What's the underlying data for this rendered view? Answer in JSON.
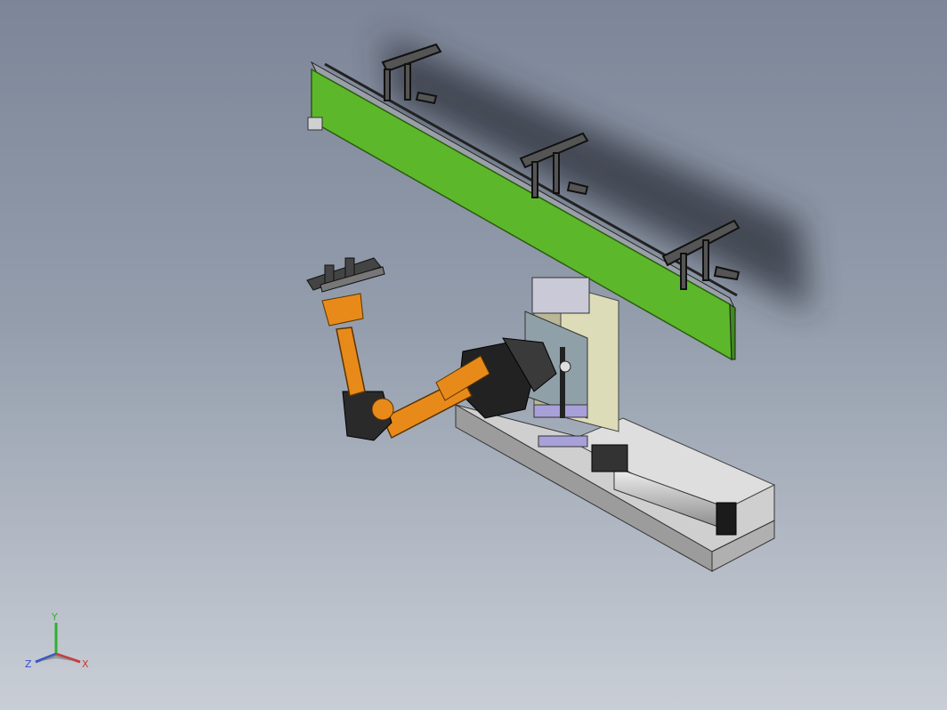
{
  "viewport": {
    "background_top": "#7d8698",
    "background_bottom": "#c9ced6"
  },
  "scene": {
    "panel_color": "#5cb82a",
    "robot_color": "#e88a1a",
    "column_color": "#dcdcb8",
    "base_color": "#c8c8c8",
    "cylinder_color": "#d8d8d8"
  },
  "triad": {
    "x_label": "X",
    "y_label": "Y",
    "z_label": "Z",
    "x_color": "#d93030",
    "y_color": "#30b030",
    "z_color": "#3050d0"
  }
}
